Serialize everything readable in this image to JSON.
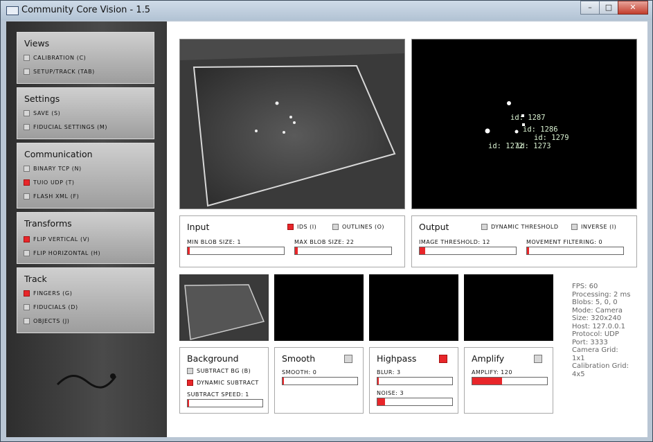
{
  "window": {
    "title": "Community Core Vision - 1.5",
    "controls": [
      "–",
      "□",
      "✕"
    ]
  },
  "sidebar": {
    "views": {
      "title": "Views",
      "items": [
        {
          "label": "CALIBRATION (C)",
          "checked": false
        },
        {
          "label": "SETUP/TRACK (TAB)",
          "checked": false
        }
      ]
    },
    "settings": {
      "title": "Settings",
      "items": [
        {
          "label": "SAVE (S)",
          "checked": false
        },
        {
          "label": "FIDUCIAL SETTINGS (M)",
          "checked": false
        }
      ]
    },
    "communication": {
      "title": "Communication",
      "items": [
        {
          "label": "BINARY TCP (N)",
          "checked": false
        },
        {
          "label": "TUIO UDP (T)",
          "checked": true
        },
        {
          "label": "FLASH XML (F)",
          "checked": false
        }
      ]
    },
    "transforms": {
      "title": "Transforms",
      "items": [
        {
          "label": "FLIP VERTICAL (V)",
          "checked": true
        },
        {
          "label": "FLIP HORIZONTAL (H)",
          "checked": false
        }
      ]
    },
    "track": {
      "title": "Track",
      "items": [
        {
          "label": "FINGERS (G)",
          "checked": true
        },
        {
          "label": "FIDUCIALS (D)",
          "checked": false
        },
        {
          "label": "OBJECTS (J)",
          "checked": false
        }
      ]
    }
  },
  "input_panel": {
    "title": "Input",
    "ids_label": "IDS (I)",
    "ids_checked": true,
    "outlines_label": "OUTLINES (O)",
    "outlines_checked": false,
    "min_blob_label": "MIN BLOB SIZE: 1",
    "min_blob_value": 0.01,
    "max_blob_label": "MAX BLOB SIZE: 22",
    "max_blob_value": 0.03
  },
  "output_panel": {
    "title": "Output",
    "dynamic_threshold_label": "DYNAMIC THRESHOLD",
    "dynamic_threshold_checked": false,
    "inverse_label": "INVERSE (I)",
    "inverse_checked": false,
    "image_threshold_label": "IMAGE THRESHOLD: 12",
    "image_threshold_value": 0.06,
    "movement_filtering_label": "MOVEMENT FILTERING: 0",
    "movement_filtering_value": 0.0
  },
  "blobs": [
    {
      "id_label": "id: 1287"
    },
    {
      "id_label": "id: 1286"
    },
    {
      "id_label": "id: 1279"
    },
    {
      "id_label": "id: 1272"
    },
    {
      "id_label": "id: 1273"
    }
  ],
  "background_panel": {
    "title": "Background",
    "subtract_bg_label": "SUBTRACT BG (B)",
    "subtract_bg_checked": false,
    "dynamic_subtract_label": "DYNAMIC SUBTRACT",
    "dynamic_subtract_checked": true,
    "subtract_speed_label": "SUBTRACT SPEED: 1",
    "subtract_speed_value": 0.01
  },
  "smooth_panel": {
    "title": "Smooth",
    "enabled": false,
    "smooth_label": "SMOOTH: 0",
    "smooth_value": 0.0
  },
  "highpass_panel": {
    "title": "Highpass",
    "enabled": true,
    "blur_label": "BLUR: 3",
    "blur_value": 0.02,
    "noise_label": "NOISE: 3",
    "noise_value": 0.1
  },
  "amplify_panel": {
    "title": "Amplify",
    "enabled": false,
    "amplify_label": "AMPLIFY: 120",
    "amplify_value": 0.4
  },
  "stats": {
    "lines": [
      "FPS: 60",
      "Processing: 2 ms",
      "Blobs: 5, 0, 0",
      "Mode: Camera",
      "Size: 320x240",
      "Host: 127.0.0.1",
      "Protocol: UDP",
      "Port: 3333",
      "Camera Grid:",
      "1x1",
      "Calibration Grid:",
      "4x5"
    ]
  },
  "colors": {
    "accent": "#e8262a",
    "sidebar_bg": "#3a3a3a",
    "panel_bg": "#bdbdbd"
  }
}
